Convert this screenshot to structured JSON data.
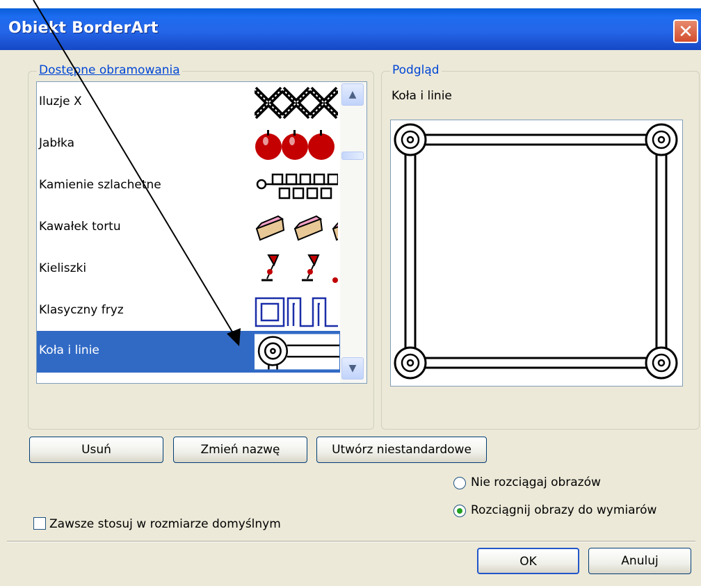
{
  "window": {
    "title": "Obiekt BorderArt",
    "close_label": "✕"
  },
  "available": {
    "legend": "Dostępne obramowania",
    "items": [
      {
        "label": "Iluzje X",
        "thumb": "iluzje-x-thumbnail"
      },
      {
        "label": "Jabłka",
        "thumb": "apples-thumbnail"
      },
      {
        "label": "Kamienie szlachetne",
        "thumb": "gems-thumbnail"
      },
      {
        "label": "Kawałek tortu",
        "thumb": "cake-thumbnail"
      },
      {
        "label": "Kieliszki",
        "thumb": "glasses-thumbnail"
      },
      {
        "label": "Klasyczny fryz",
        "thumb": "frieze-thumbnail"
      },
      {
        "label": "Koła i linie",
        "thumb": "circles-lines-thumbnail",
        "selected": true
      }
    ]
  },
  "preview": {
    "legend": "Podgląd",
    "name": "Koła i linie"
  },
  "buttons": {
    "delete": "Usuń",
    "rename": "Zmień nazwę",
    "custom": "Utwórz niestandardowe",
    "ok": "OK",
    "cancel": "Anuluj"
  },
  "options": {
    "no_stretch": "Nie rozciągaj obrazów",
    "stretch": "Rozciągnij obrazy do wymiarów",
    "selected": "stretch"
  },
  "default_size_checkbox": {
    "label": "Zawsze stosuj w rozmiarze domyślnym",
    "checked": false
  },
  "colors": {
    "title_bar": "#2566e8",
    "selection": "#316ac5",
    "dialog_bg": "#ece9d8",
    "legend": "#0046d5"
  }
}
